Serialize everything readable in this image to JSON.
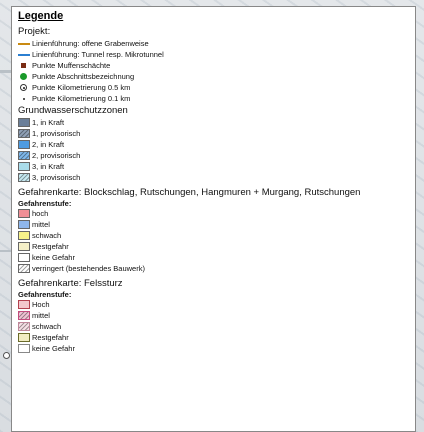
{
  "legend": {
    "title": "Legende",
    "projekt": {
      "heading": "Projekt:",
      "items": [
        {
          "label": "Linienführung: offene Grabenweise",
          "symbol": "line",
          "color": "#c98a12"
        },
        {
          "label": "Linienführung: Tunnel resp. Mikrotunnel",
          "symbol": "line",
          "color": "#2b7fd1"
        },
        {
          "label": "Punkte Muffenschächte",
          "symbol": "square",
          "color": "#7a2c14"
        },
        {
          "label": "Punkte Abschnittsbezeichnung",
          "symbol": "dot",
          "color": "#1a9a2a"
        },
        {
          "label": "Punkte Kilometrierung 0.5 km",
          "symbol": "circle-dot",
          "color": "#333333"
        },
        {
          "label": "Punkte Kilometrierung 0.1 km",
          "symbol": "small-dot",
          "color": "#222222"
        }
      ]
    },
    "grundwasser": {
      "heading": "Grundwasserschutzzonen",
      "items": [
        {
          "label": "1, in Kraft",
          "fill": "#6b7f99",
          "hatch": false
        },
        {
          "label": "1, provisorisch",
          "fill": "#8fa0b6",
          "hatch": true
        },
        {
          "label": "2, in Kraft",
          "fill": "#4e9be0",
          "hatch": false
        },
        {
          "label": "2, provisorisch",
          "fill": "#7fb8ea",
          "hatch": true
        },
        {
          "label": "3, in Kraft",
          "fill": "#a9dcea",
          "hatch": false
        },
        {
          "label": "3, provisorisch",
          "fill": "#c6e9f1",
          "hatch": true
        }
      ]
    },
    "gefahren_block": {
      "heading": "Gefahrenkarte: Blockschlag, Rutschungen, Hangmuren + Murgang, Rutschungen",
      "subheading": "Gefahrenstufe:",
      "items": [
        {
          "label": "hoch",
          "fill": "#f08f96",
          "hatch": false
        },
        {
          "label": "mittel",
          "fill": "#8fb7ec",
          "hatch": false
        },
        {
          "label": "schwach",
          "fill": "#f6f28a",
          "hatch": false
        },
        {
          "label": "Restgefahr",
          "fill": "#f5f0c8",
          "hatch": false
        },
        {
          "label": "keine Gefahr",
          "fill": "#ffffff",
          "hatch": false
        },
        {
          "label": "verringert (bestehendes Bauwerk)",
          "fill": "#ffffff",
          "hatch": true
        }
      ]
    },
    "gefahren_fels": {
      "heading": "Gefahrenkarte: Felssturz",
      "subheading": "Gefahrenstufe:",
      "items": [
        {
          "label": "Hoch",
          "fill": "#f3c7cc",
          "border": "#b3414f",
          "hatch": false
        },
        {
          "label": "mittel",
          "fill": "#f0c3d4",
          "border": "#c44c7e",
          "hatch": true
        },
        {
          "label": "schwach",
          "fill": "#f6dfe5",
          "border": "#c0879a",
          "hatch": true
        },
        {
          "label": "Restgefahr",
          "fill": "#f1ecc2",
          "border": "#6b6b2a",
          "hatch": false
        },
        {
          "label": "keine Gefahr",
          "fill": "#ffffff",
          "border": "#888888",
          "hatch": false
        }
      ]
    }
  }
}
